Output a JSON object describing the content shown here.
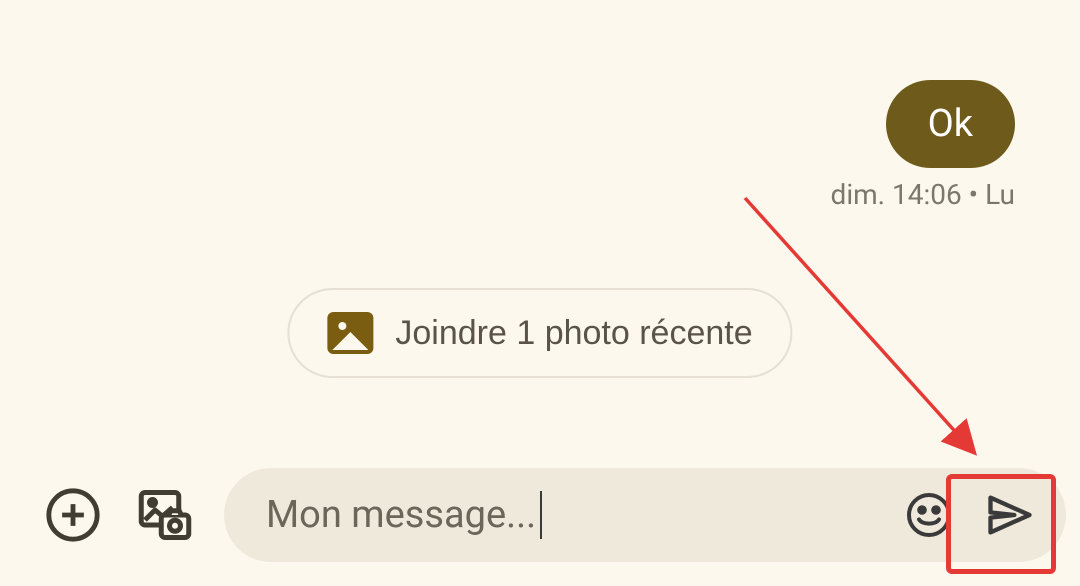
{
  "message": {
    "text": "Ok",
    "meta": "dim. 14:06 • Lu"
  },
  "suggestion": {
    "label": "Joindre 1 photo récente"
  },
  "input": {
    "text": "Mon message..."
  }
}
